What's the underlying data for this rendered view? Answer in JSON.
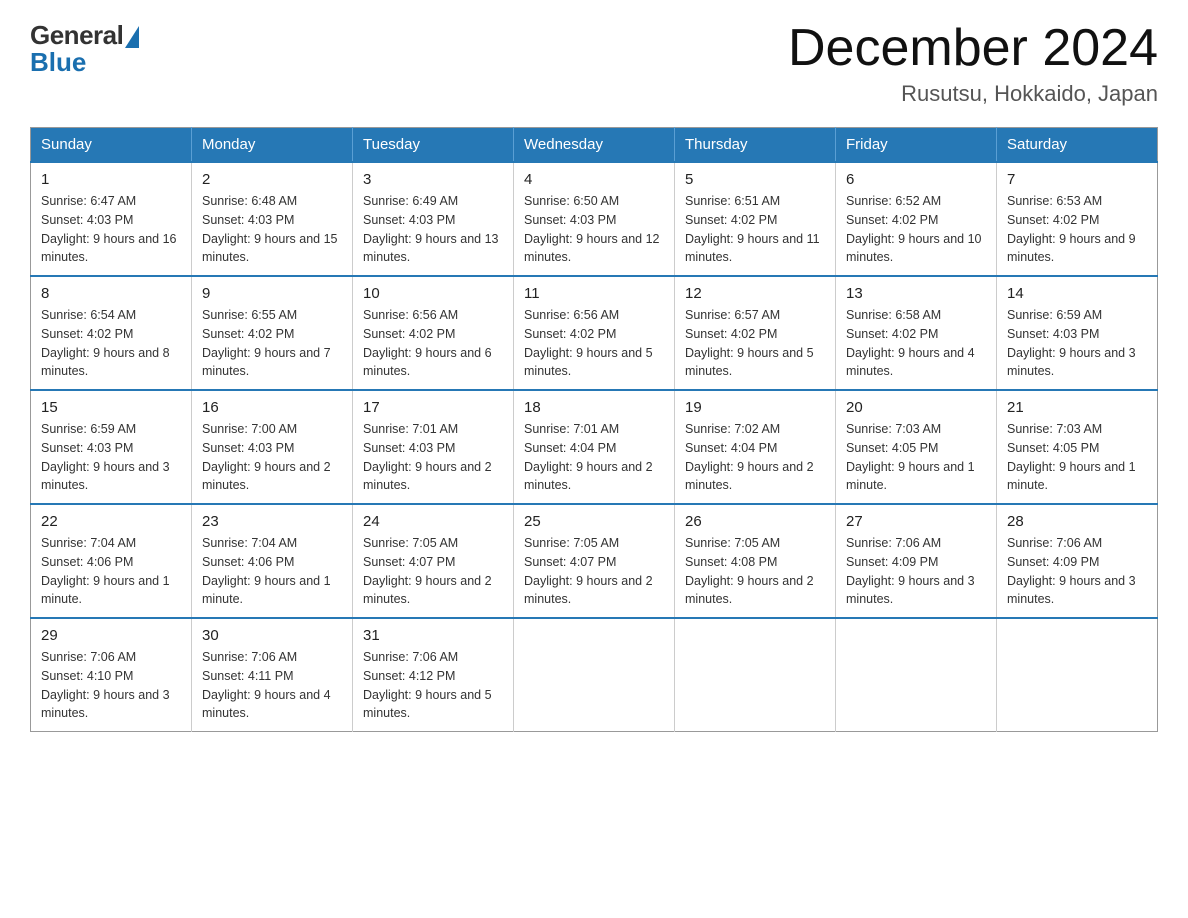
{
  "header": {
    "logo_general": "General",
    "logo_blue": "Blue",
    "month_title": "December 2024",
    "location": "Rusutsu, Hokkaido, Japan"
  },
  "days_of_week": [
    "Sunday",
    "Monday",
    "Tuesday",
    "Wednesday",
    "Thursday",
    "Friday",
    "Saturday"
  ],
  "weeks": [
    [
      {
        "day": "1",
        "sunrise": "6:47 AM",
        "sunset": "4:03 PM",
        "daylight": "9 hours and 16 minutes."
      },
      {
        "day": "2",
        "sunrise": "6:48 AM",
        "sunset": "4:03 PM",
        "daylight": "9 hours and 15 minutes."
      },
      {
        "day": "3",
        "sunrise": "6:49 AM",
        "sunset": "4:03 PM",
        "daylight": "9 hours and 13 minutes."
      },
      {
        "day": "4",
        "sunrise": "6:50 AM",
        "sunset": "4:03 PM",
        "daylight": "9 hours and 12 minutes."
      },
      {
        "day": "5",
        "sunrise": "6:51 AM",
        "sunset": "4:02 PM",
        "daylight": "9 hours and 11 minutes."
      },
      {
        "day": "6",
        "sunrise": "6:52 AM",
        "sunset": "4:02 PM",
        "daylight": "9 hours and 10 minutes."
      },
      {
        "day": "7",
        "sunrise": "6:53 AM",
        "sunset": "4:02 PM",
        "daylight": "9 hours and 9 minutes."
      }
    ],
    [
      {
        "day": "8",
        "sunrise": "6:54 AM",
        "sunset": "4:02 PM",
        "daylight": "9 hours and 8 minutes."
      },
      {
        "day": "9",
        "sunrise": "6:55 AM",
        "sunset": "4:02 PM",
        "daylight": "9 hours and 7 minutes."
      },
      {
        "day": "10",
        "sunrise": "6:56 AM",
        "sunset": "4:02 PM",
        "daylight": "9 hours and 6 minutes."
      },
      {
        "day": "11",
        "sunrise": "6:56 AM",
        "sunset": "4:02 PM",
        "daylight": "9 hours and 5 minutes."
      },
      {
        "day": "12",
        "sunrise": "6:57 AM",
        "sunset": "4:02 PM",
        "daylight": "9 hours and 5 minutes."
      },
      {
        "day": "13",
        "sunrise": "6:58 AM",
        "sunset": "4:02 PM",
        "daylight": "9 hours and 4 minutes."
      },
      {
        "day": "14",
        "sunrise": "6:59 AM",
        "sunset": "4:03 PM",
        "daylight": "9 hours and 3 minutes."
      }
    ],
    [
      {
        "day": "15",
        "sunrise": "6:59 AM",
        "sunset": "4:03 PM",
        "daylight": "9 hours and 3 minutes."
      },
      {
        "day": "16",
        "sunrise": "7:00 AM",
        "sunset": "4:03 PM",
        "daylight": "9 hours and 2 minutes."
      },
      {
        "day": "17",
        "sunrise": "7:01 AM",
        "sunset": "4:03 PM",
        "daylight": "9 hours and 2 minutes."
      },
      {
        "day": "18",
        "sunrise": "7:01 AM",
        "sunset": "4:04 PM",
        "daylight": "9 hours and 2 minutes."
      },
      {
        "day": "19",
        "sunrise": "7:02 AM",
        "sunset": "4:04 PM",
        "daylight": "9 hours and 2 minutes."
      },
      {
        "day": "20",
        "sunrise": "7:03 AM",
        "sunset": "4:05 PM",
        "daylight": "9 hours and 1 minute."
      },
      {
        "day": "21",
        "sunrise": "7:03 AM",
        "sunset": "4:05 PM",
        "daylight": "9 hours and 1 minute."
      }
    ],
    [
      {
        "day": "22",
        "sunrise": "7:04 AM",
        "sunset": "4:06 PM",
        "daylight": "9 hours and 1 minute."
      },
      {
        "day": "23",
        "sunrise": "7:04 AM",
        "sunset": "4:06 PM",
        "daylight": "9 hours and 1 minute."
      },
      {
        "day": "24",
        "sunrise": "7:05 AM",
        "sunset": "4:07 PM",
        "daylight": "9 hours and 2 minutes."
      },
      {
        "day": "25",
        "sunrise": "7:05 AM",
        "sunset": "4:07 PM",
        "daylight": "9 hours and 2 minutes."
      },
      {
        "day": "26",
        "sunrise": "7:05 AM",
        "sunset": "4:08 PM",
        "daylight": "9 hours and 2 minutes."
      },
      {
        "day": "27",
        "sunrise": "7:06 AM",
        "sunset": "4:09 PM",
        "daylight": "9 hours and 3 minutes."
      },
      {
        "day": "28",
        "sunrise": "7:06 AM",
        "sunset": "4:09 PM",
        "daylight": "9 hours and 3 minutes."
      }
    ],
    [
      {
        "day": "29",
        "sunrise": "7:06 AM",
        "sunset": "4:10 PM",
        "daylight": "9 hours and 3 minutes."
      },
      {
        "day": "30",
        "sunrise": "7:06 AM",
        "sunset": "4:11 PM",
        "daylight": "9 hours and 4 minutes."
      },
      {
        "day": "31",
        "sunrise": "7:06 AM",
        "sunset": "4:12 PM",
        "daylight": "9 hours and 5 minutes."
      },
      null,
      null,
      null,
      null
    ]
  ],
  "labels": {
    "sunrise": "Sunrise:",
    "sunset": "Sunset:",
    "daylight": "Daylight:"
  }
}
